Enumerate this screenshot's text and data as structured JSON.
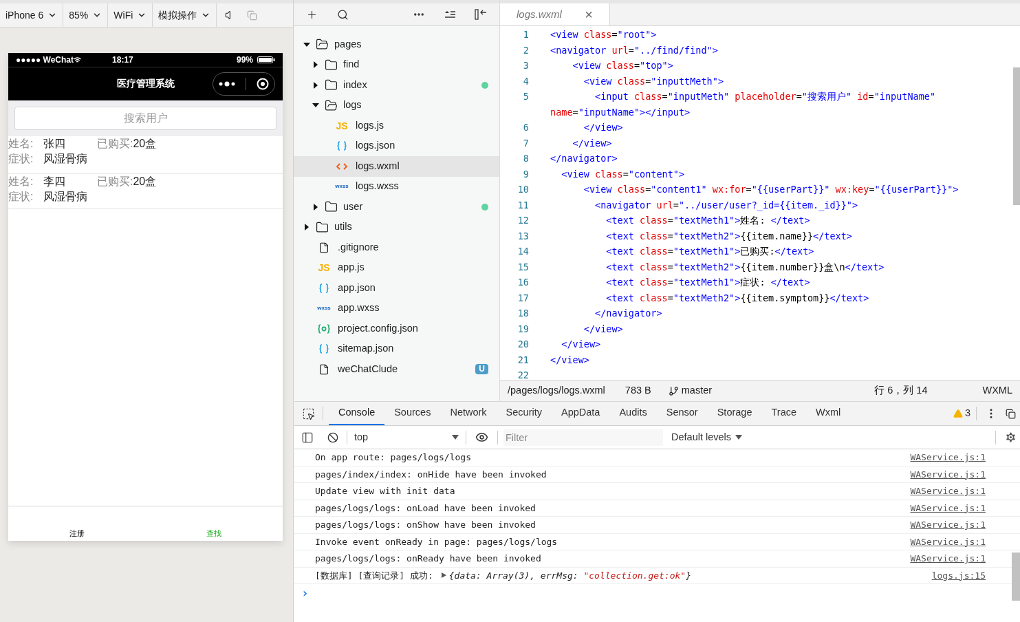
{
  "simulator": {
    "toolbar": [
      {
        "label": "iPhone 6"
      },
      {
        "label": "85%"
      },
      {
        "label": "WiFi"
      },
      {
        "label": "模拟操作"
      }
    ],
    "phone": {
      "carrier": "●●●●● WeChat",
      "time": "18:17",
      "battery": "99%",
      "title": "医疗管理系统",
      "search": {
        "placeholder": "搜索用户"
      },
      "records": [
        {
          "name_label": "姓名:",
          "name": "张四",
          "bought_label": "已购买:",
          "bought": "20盒",
          "symptom_label": "症状:",
          "symptom": "风湿骨病"
        },
        {
          "name_label": "姓名:",
          "name": "李四",
          "bought_label": "已购买:",
          "bought": "20盒",
          "symptom_label": "症状:",
          "symptom": "风湿骨病"
        }
      ],
      "tabbar": [
        {
          "label": "注册",
          "selected": false
        },
        {
          "label": "查找",
          "selected": true
        }
      ]
    }
  },
  "file_tree": [
    {
      "name": "pages",
      "kind": "folder",
      "expanded": true,
      "selected": false,
      "children": [
        {
          "name": "find",
          "kind": "folder",
          "expanded": false,
          "selected": false
        },
        {
          "name": "index",
          "kind": "folder",
          "expanded": false,
          "selected": false,
          "color": "#5fd3a0"
        },
        {
          "name": "logs",
          "kind": "folder",
          "expanded": true,
          "selected": false,
          "children": [
            {
              "name": "logs.js",
              "kind": "js",
              "icon": "JS",
              "selected": false
            },
            {
              "name": "logs.json",
              "kind": "json",
              "selected": false
            },
            {
              "name": "logs.wxml",
              "kind": "wxml",
              "selected": true
            },
            {
              "name": "logs.wxss",
              "kind": "wxss",
              "icon": "wxss",
              "selected": false
            }
          ]
        },
        {
          "name": "user",
          "kind": "folder",
          "expanded": false,
          "selected": false,
          "color": "#5fd3a0"
        }
      ]
    },
    {
      "name": "utils",
      "kind": "folder",
      "expanded": false,
      "selected": false
    },
    {
      "name": ".gitignore",
      "kind": "file",
      "selected": false
    },
    {
      "name": "app.js",
      "kind": "js",
      "icon": "JS",
      "selected": false
    },
    {
      "name": "app.json",
      "kind": "json",
      "selected": false
    },
    {
      "name": "app.wxss",
      "kind": "wxss",
      "icon": "wxss",
      "selected": false
    },
    {
      "name": "project.config.json",
      "kind": "config",
      "selected": false
    },
    {
      "name": "sitemap.json",
      "kind": "json",
      "selected": false
    },
    {
      "name": "weChatClude",
      "kind": "file",
      "selected": false,
      "badge": "U"
    }
  ],
  "editor": {
    "tab": {
      "title": "logs.wxml",
      "close": "×"
    },
    "lines": [
      {
        "number": "1",
        "code": "<view class=\"root\">"
      },
      {
        "number": "2",
        "code": "<navigator url=\"../find/find\">"
      },
      {
        "number": "3",
        "code": "    <view class=\"top\">"
      },
      {
        "number": "4",
        "code": "      <view class=\"inputtMeth\">"
      },
      {
        "number": "5",
        "code": "        <input class=\"inputMeth\" placeholder=\"搜索用户\" id=\"inputName\""
      },
      {
        "code": "name=\"inputName\"></input>"
      },
      {
        "number": "6",
        "code": "      </view>"
      },
      {
        "number": "7",
        "code": "    </view>"
      },
      {
        "number": "8",
        "code": "</navigator>"
      },
      {
        "number": "9",
        "code": "  <view class=\"content\">"
      },
      {
        "number": "10",
        "code": "      <view class=\"content1\" wx:for=\"{{userPart}}\" wx:key=\"{{userPart}}\">"
      },
      {
        "number": "11",
        "code": "        <navigator url=\"../user/user?_id={{item._id}}\">"
      },
      {
        "number": "12",
        "code": "          <text class=\"textMeth1\">姓名: </text>"
      },
      {
        "number": "13",
        "code": "          <text class=\"textMeth2\">{{item.name}}</text>"
      },
      {
        "number": "14",
        "code": "          <text class=\"textMeth1\">已购买:</text>"
      },
      {
        "number": "15",
        "code": "          <text class=\"textMeth2\">{{item.number}}盒\\n</text>"
      },
      {
        "number": "16",
        "code": "          <text class=\"textMeth1\">症状: </text>"
      },
      {
        "number": "17",
        "code": "          <text class=\"textMeth2\">{{item.symptom}}</text>"
      },
      {
        "number": "18",
        "code": "        </navigator>"
      },
      {
        "number": "19",
        "code": "      </view>"
      },
      {
        "number": "20",
        "code": "  </view>"
      },
      {
        "number": "21",
        "code": "</view>"
      },
      {
        "number": "22"
      }
    ],
    "status_bar": {
      "path": "/pages/logs/logs.wxml",
      "size": "783 B",
      "branch": "master",
      "position": "行 6，列 14",
      "language": "WXML"
    }
  },
  "devtools": {
    "tabs": [
      {
        "label": "Console",
        "selected": true
      },
      {
        "label": "Sources",
        "selected": false
      },
      {
        "label": "Network",
        "selected": false
      },
      {
        "label": "Security",
        "selected": false
      },
      {
        "label": "AppData",
        "selected": false
      },
      {
        "label": "Audits",
        "selected": false
      },
      {
        "label": "Sensor",
        "selected": false
      },
      {
        "label": "Storage",
        "selected": false
      },
      {
        "label": "Trace",
        "selected": false
      },
      {
        "label": "Wxml",
        "selected": false
      }
    ],
    "warnings": "3",
    "context": "top",
    "filter": {
      "placeholder": "Filter"
    },
    "levels": "Default levels",
    "messages": [
      {
        "kind": "text",
        "text": "On app route: pages/logs/logs",
        "source": "WAService.js:1"
      },
      {
        "kind": "text",
        "text": "pages/index/index: onHide have been invoked",
        "source": "WAService.js:1"
      },
      {
        "kind": "text",
        "text": "Update view with init data",
        "source": "WAService.js:1"
      },
      {
        "kind": "text",
        "text": "pages/logs/logs: onLoad have been invoked",
        "source": "WAService.js:1"
      },
      {
        "kind": "text",
        "text": "pages/logs/logs: onShow have been invoked",
        "source": "WAService.js:1"
      },
      {
        "kind": "text",
        "text": "Invoke event onReady in page: pages/logs/logs",
        "source": "WAService.js:1"
      },
      {
        "kind": "text",
        "text": "pages/logs/logs: onReady have been invoked",
        "source": "WAService.js:1"
      },
      {
        "kind": "object",
        "text": "[数据库] [查询记录] 成功:",
        "object": "{data: Array(3), errMsg: ",
        "string": "\"collection.get:ok\"",
        "close": "}",
        "source": "logs.js:15"
      }
    ],
    "prompt": "›"
  }
}
